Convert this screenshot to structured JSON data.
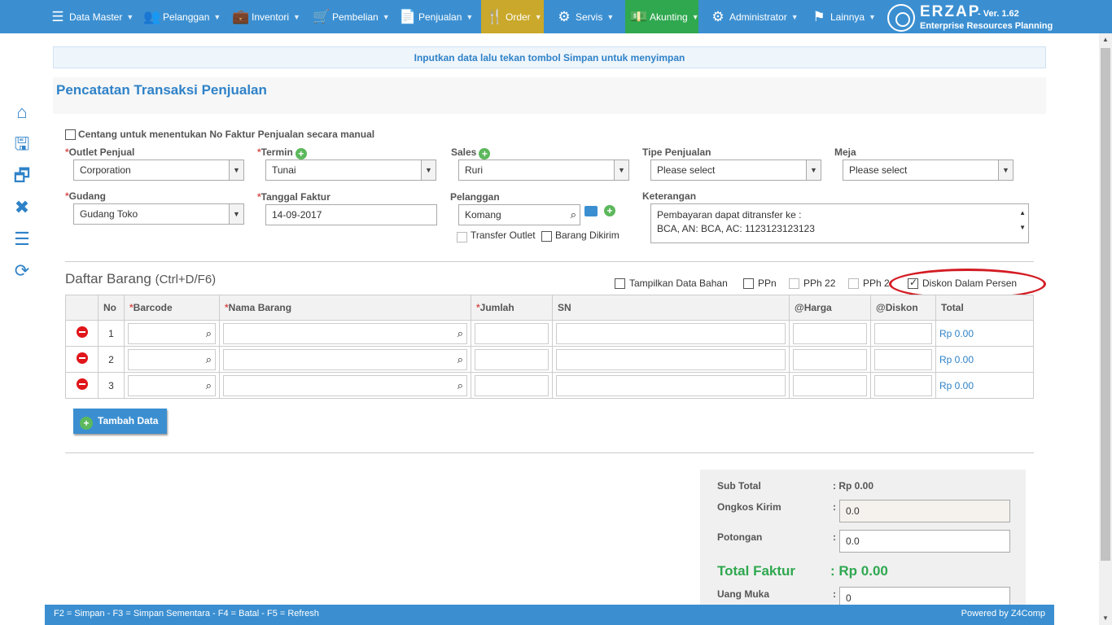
{
  "nav": {
    "items": [
      {
        "label": "Data Master",
        "icon": "list-icon"
      },
      {
        "label": "Pelanggan",
        "icon": "users-icon"
      },
      {
        "label": "Inventori",
        "icon": "briefcase-icon"
      },
      {
        "label": "Pembelian",
        "icon": "cart-icon"
      },
      {
        "label": "Penjualan",
        "icon": "document-icon"
      },
      {
        "label": "Order",
        "icon": "cutlery-icon"
      },
      {
        "label": "Servis",
        "icon": "gears-icon"
      },
      {
        "label": "Akunting",
        "icon": "money-icon"
      },
      {
        "label": "Administrator",
        "icon": "gear-icon"
      },
      {
        "label": "Lainnya",
        "icon": "flag-icon"
      }
    ],
    "brand": {
      "name": "ERZAP",
      "version": "- Ver. 1.62",
      "subtitle": "Enterprise Resources Planning"
    },
    "colors": {
      "bar": "#3b8fd1",
      "order": "#c9a82b",
      "akunting": "#2fa84f"
    }
  },
  "notice": "Inputkan data lalu tekan tombol Simpan untuk menyimpan",
  "page_title": "Pencatatan Transaksi Penjualan",
  "form": {
    "manual_invoice_label": "Centang untuk menentukan No Faktur Penjualan secara manual",
    "outlet": {
      "label": "Outlet Penjual",
      "value": "Corporation"
    },
    "termin": {
      "label": "Termin",
      "value": "Tunai"
    },
    "sales": {
      "label": "Sales",
      "value": "Ruri"
    },
    "tipe": {
      "label": "Tipe Penjualan",
      "value": "Please select"
    },
    "meja": {
      "label": "Meja",
      "value": "Please select"
    },
    "gudang": {
      "label": "Gudang",
      "value": "Gudang Toko"
    },
    "tanggal": {
      "label": "Tanggal Faktur",
      "value": "14-09-2017"
    },
    "pelanggan": {
      "label": "Pelanggan",
      "value": "Komang"
    },
    "transfer_outlet": "Transfer Outlet",
    "barang_dikirim": "Barang Dikirim",
    "keterangan": {
      "label": "Keterangan",
      "line1": "Pembayaran dapat ditransfer ke :",
      "line2": "BCA, AN: BCA, AC: 1123123123123"
    }
  },
  "items_section": {
    "title": "Daftar Barang",
    "shortcut": "(Ctrl+D/F6)",
    "options": {
      "tampilkan": "Tampilkan Data Bahan",
      "ppn": "PPn",
      "pph22": "PPh 22",
      "pph23": "PPh 2",
      "diskon_persen": "Diskon Dalam Persen"
    },
    "columns": [
      "No",
      "Barcode",
      "Nama Barang",
      "Jumlah",
      "SN",
      "@Harga",
      "@Diskon",
      "Total"
    ],
    "rows": [
      {
        "no": "1",
        "total": "Rp 0.00"
      },
      {
        "no": "2",
        "total": "Rp 0.00"
      },
      {
        "no": "3",
        "total": "Rp 0.00"
      }
    ],
    "add_button": "Tambah Data"
  },
  "summary": {
    "sub_total_label": "Sub Total",
    "sub_total_value": ": Rp 0.00",
    "ongkos_label": "Ongkos Kirim",
    "ongkos_value": "0.0",
    "potongan_label": "Potongan",
    "potongan_value": "0.0",
    "total_label": "Total Faktur",
    "total_value": ": Rp 0.00",
    "uang_muka_label": "Uang Muka",
    "uang_muka_value": "0",
    "colon": ":"
  },
  "footer": {
    "shortcuts": "F2 = Simpan - F3 = Simpan Sementara - F4 = Batal - F5 = Refresh",
    "powered": "Powered by Z4Comp"
  }
}
